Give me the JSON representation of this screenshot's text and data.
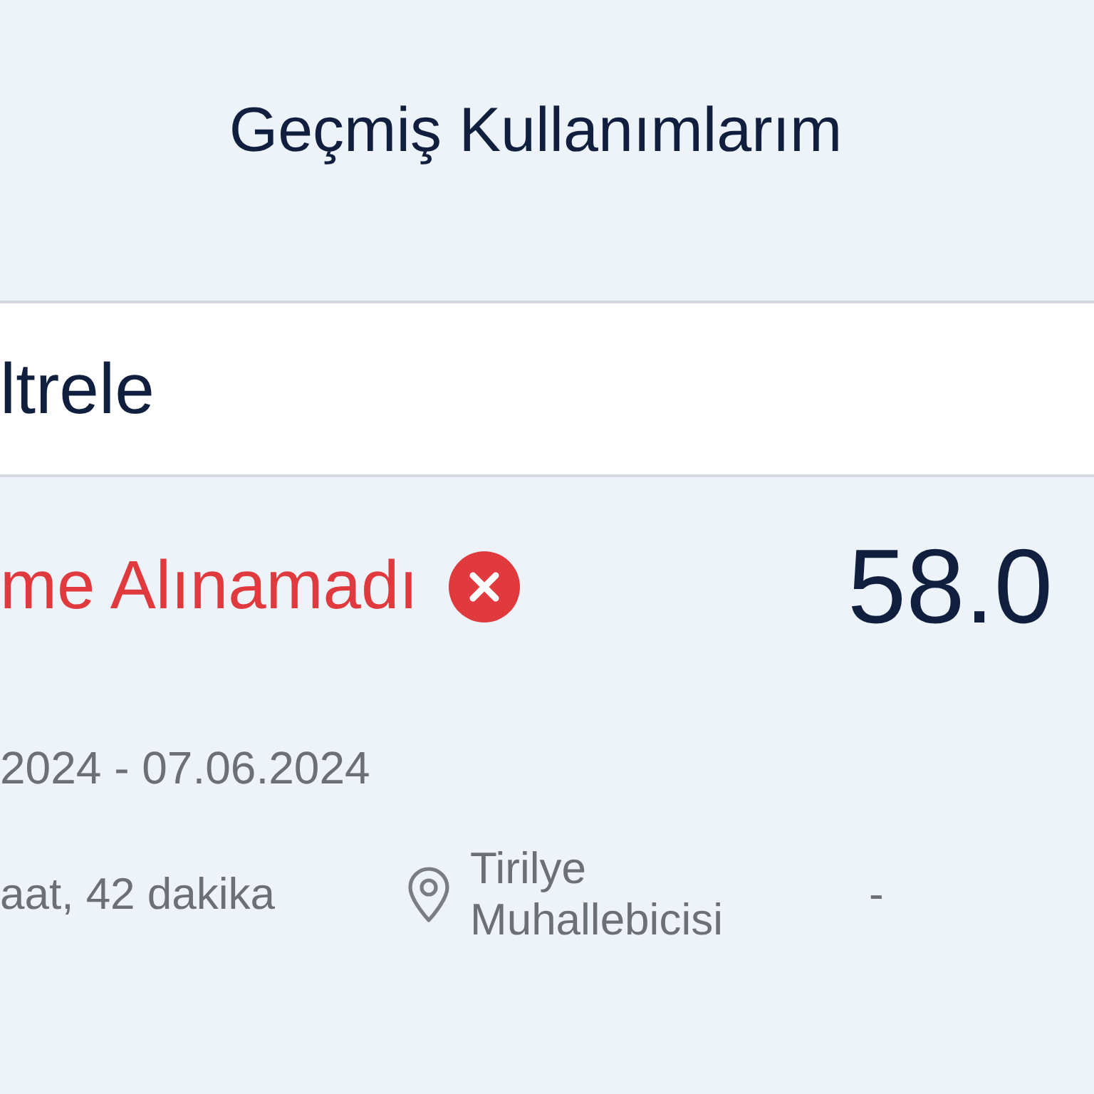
{
  "header": {
    "title": "Geçmiş Kullanımlarım"
  },
  "filter_bar": {
    "label": "ltrele"
  },
  "usages": [
    {
      "kind": "failed",
      "status": "me Alınamadı",
      "amount": "58.0",
      "date_range": "2024 - 07.06.2024",
      "duration": "aat, 42 dakika",
      "location": "Tirilye Muhallebicisi",
      "column_4": "-"
    }
  ]
}
